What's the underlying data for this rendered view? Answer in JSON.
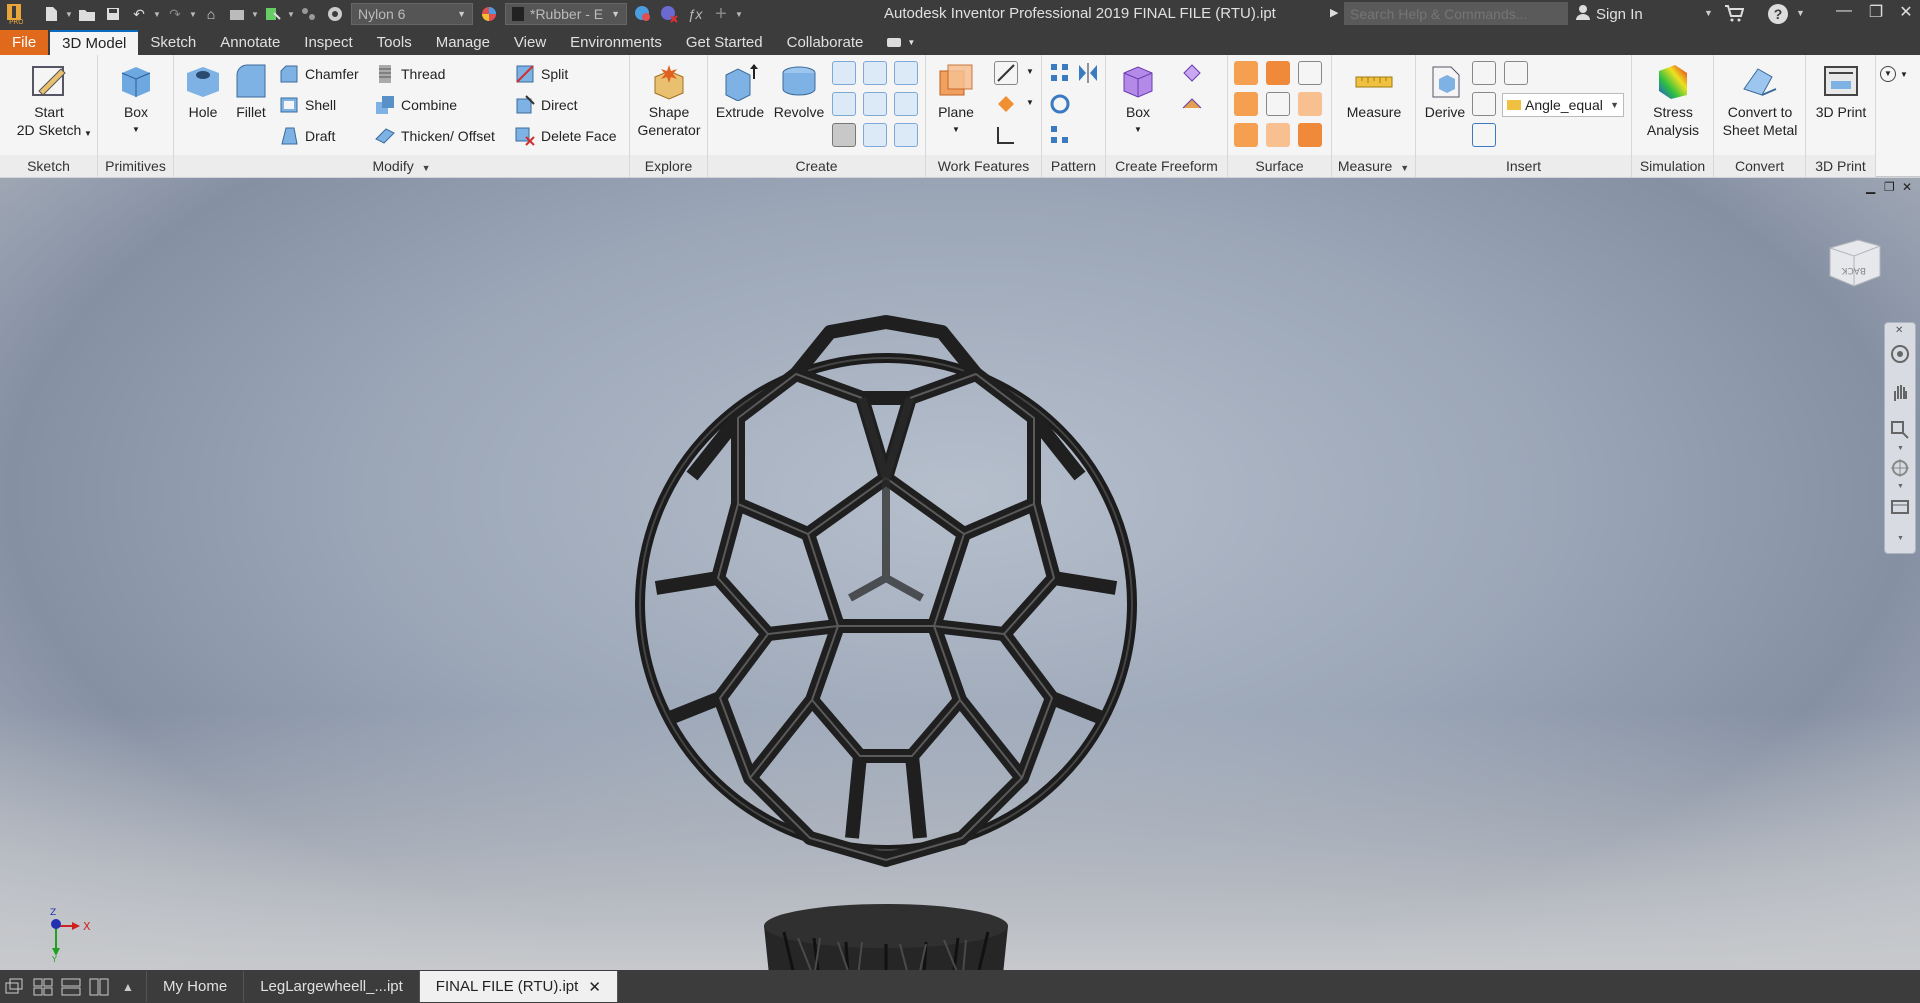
{
  "titlebar": {
    "material_combo": "Nylon 6",
    "appearance_combo": "*Rubber - E",
    "app_title": "Autodesk Inventor Professional 2019    FINAL FILE (RTU).ipt",
    "search_placeholder": "Search Help & Commands...",
    "signin_label": "Sign In"
  },
  "tabs": [
    {
      "label": "File"
    },
    {
      "label": "3D Model"
    },
    {
      "label": "Sketch"
    },
    {
      "label": "Annotate"
    },
    {
      "label": "Inspect"
    },
    {
      "label": "Tools"
    },
    {
      "label": "Manage"
    },
    {
      "label": "View"
    },
    {
      "label": "Environments"
    },
    {
      "label": "Get Started"
    },
    {
      "label": "Collaborate"
    }
  ],
  "ribbon": {
    "sketch": {
      "title": "Sketch",
      "start_line1": "Start",
      "start_line2": "2D Sketch"
    },
    "primitives": {
      "title": "Primitives",
      "box": "Box"
    },
    "modify": {
      "title": "Modify",
      "hole": "Hole",
      "fillet": "Fillet",
      "chamfer": "Chamfer",
      "shell": "Shell",
      "draft": "Draft",
      "thread": "Thread",
      "combine": "Combine",
      "thicken": "Thicken/ Offset",
      "split": "Split",
      "direct": "Direct",
      "delete_face": "Delete Face"
    },
    "explore": {
      "title": "Explore",
      "shape_line1": "Shape",
      "shape_line2": "Generator"
    },
    "create": {
      "title": "Create",
      "extrude": "Extrude",
      "revolve": "Revolve"
    },
    "work_features": {
      "title": "Work Features",
      "plane": "Plane"
    },
    "pattern": {
      "title": "Pattern"
    },
    "create_freeform": {
      "title": "Create Freeform",
      "box": "Box"
    },
    "surface": {
      "title": "Surface"
    },
    "measure": {
      "title": "Measure",
      "measure": "Measure"
    },
    "insert": {
      "title": "Insert",
      "derive": "Derive",
      "parameter": "Angle_equal"
    },
    "simulation": {
      "title": "Simulation",
      "stress_line1": "Stress",
      "stress_line2": "Analysis"
    },
    "convert": {
      "title": "Convert",
      "line1": "Convert to",
      "line2": "Sheet Metal"
    },
    "print3d": {
      "title": "3D Print",
      "button": "3D Print"
    }
  },
  "viewcube_face": "BACK",
  "axis": {
    "x": "X",
    "y": "Y",
    "z": "Z"
  },
  "statusbar": {
    "home_tab": "My Home",
    "doc_tabs": [
      {
        "label": "LegLargewheell_...ipt"
      },
      {
        "label": "FINAL FILE (RTU).ipt"
      }
    ]
  },
  "colors": {
    "file_tab": "#e0691b",
    "accent": "#0b6bbf",
    "chrome": "#3c3c3c",
    "model": "#2a2a2a"
  }
}
